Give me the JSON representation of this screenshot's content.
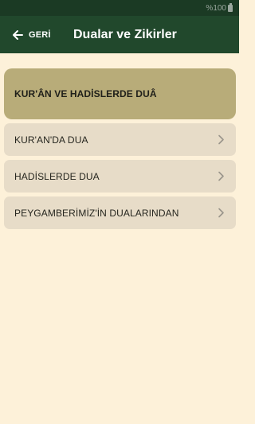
{
  "status_bar": {
    "battery_text": "%100"
  },
  "app_bar": {
    "back_label": "GERİ",
    "title": "Dualar ve Zikirler"
  },
  "header_card": {
    "title": "KUR'ÂN VE HADİSLERDE DUÂ"
  },
  "menu": {
    "items": [
      {
        "label": "KUR'AN'DA DUA"
      },
      {
        "label": "HADİSLERDE DUA"
      },
      {
        "label": "PEYGAMBERİMİZ'İN DUALARINDAN"
      }
    ]
  },
  "colors": {
    "status_bar_bg": "#1b3a24",
    "app_bar_bg": "#21482c",
    "page_bg": "#fdf1d9",
    "header_card_bg": "#b8ac79",
    "menu_item_bg": "#e7dcc8"
  }
}
